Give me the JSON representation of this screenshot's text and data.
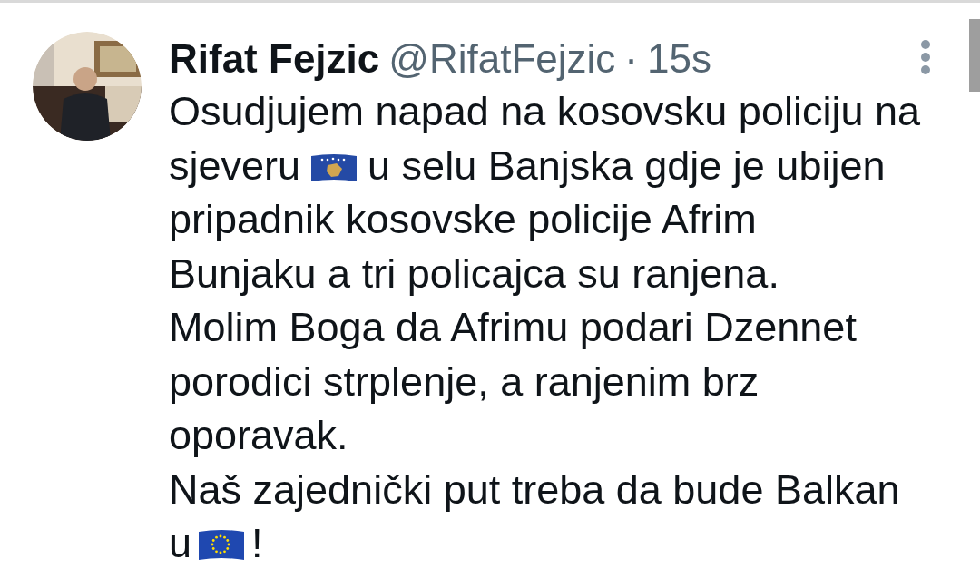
{
  "tweet": {
    "author": {
      "name": "Rifat Fejzic",
      "handle": "@RifatFejzic",
      "separator": "·",
      "time": "15s"
    },
    "lines": [
      [
        {
          "kind": "text",
          "text": "Osudjujem napad na kosovsku policiju na"
        }
      ],
      [
        {
          "kind": "text",
          "text": "sjeveru"
        },
        {
          "kind": "kosovo"
        },
        {
          "kind": "text",
          "text": "u selu Banjska gdje je ubijen"
        }
      ],
      [
        {
          "kind": "text",
          "text": "pripadnik kosovske policije Afrim"
        }
      ],
      [
        {
          "kind": "text",
          "text": "Bunjaku a tri policajca su ranjena."
        }
      ],
      [
        {
          "kind": "text",
          "text": "Molim Boga da Afrimu podari Dzennet"
        }
      ],
      [
        {
          "kind": "text",
          "text": "porodici strplenje, a ranjenim brz"
        }
      ],
      [
        {
          "kind": "text",
          "text": "oporavak."
        }
      ],
      [
        {
          "kind": "text",
          "text": "Naš zajednički put treba da bude Balkan"
        }
      ],
      [
        {
          "kind": "text",
          "text": "u"
        },
        {
          "kind": "eu"
        },
        {
          "kind": "text",
          "text": "!"
        }
      ]
    ]
  }
}
